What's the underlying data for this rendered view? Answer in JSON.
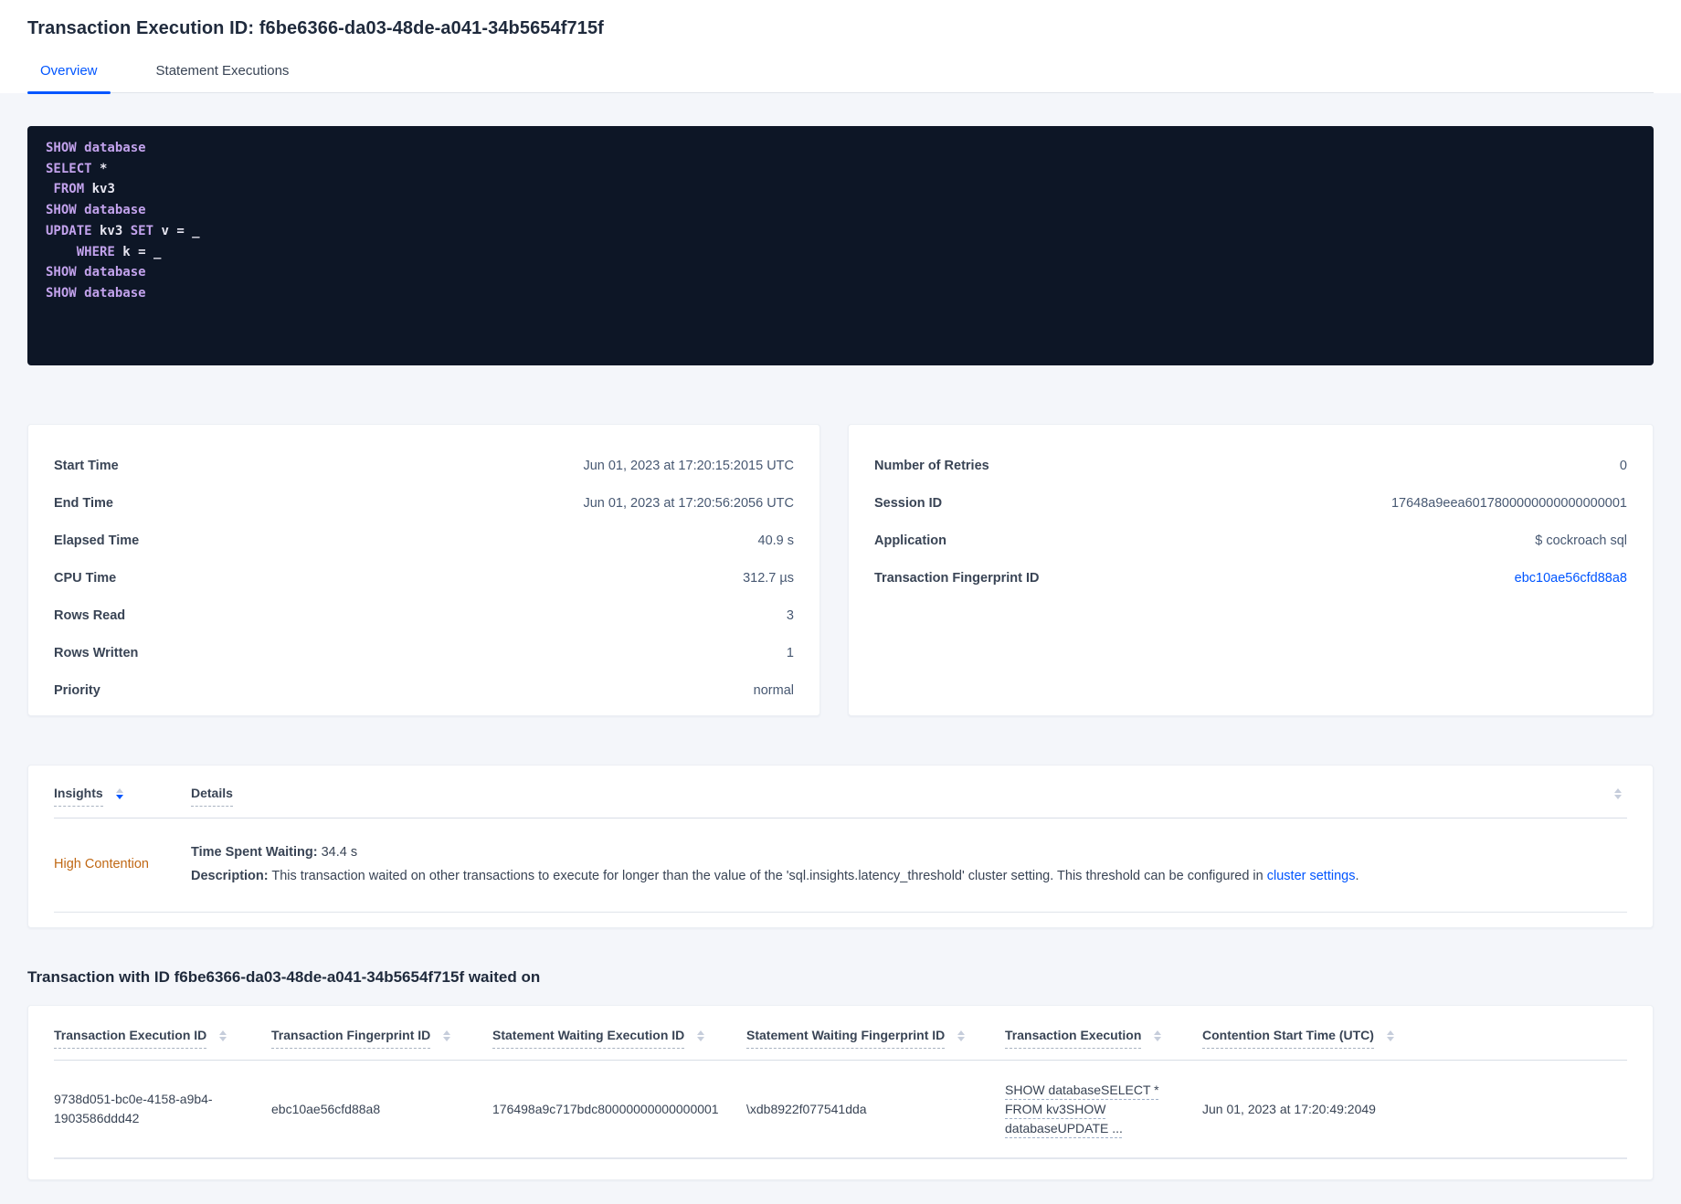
{
  "page": {
    "title": "Transaction Execution ID: f6be6366-da03-48de-a041-34b5654f715f",
    "tabs": [
      {
        "label": "Overview",
        "active": true
      },
      {
        "label": "Statement Executions",
        "active": false
      }
    ]
  },
  "sql_box": {
    "lines": [
      [
        {
          "t": "kw",
          "v": "SHOW database"
        }
      ],
      [
        {
          "t": "kw",
          "v": "SELECT"
        },
        {
          "t": "pl",
          "v": " *"
        }
      ],
      [
        {
          "t": "pl",
          "v": " "
        },
        {
          "t": "kw",
          "v": "FROM"
        },
        {
          "t": "pl",
          "v": " kv3"
        }
      ],
      [
        {
          "t": "kw",
          "v": "SHOW database"
        }
      ],
      [
        {
          "t": "kw",
          "v": "UPDATE"
        },
        {
          "t": "pl",
          "v": " kv3 "
        },
        {
          "t": "kw",
          "v": "SET"
        },
        {
          "t": "pl",
          "v": " v = _"
        }
      ],
      [
        {
          "t": "pl",
          "v": "    "
        },
        {
          "t": "kw",
          "v": "WHERE"
        },
        {
          "t": "pl",
          "v": " k = _"
        }
      ],
      [
        {
          "t": "kw",
          "v": "SHOW database"
        }
      ],
      [
        {
          "t": "kw",
          "v": "SHOW database"
        }
      ]
    ]
  },
  "summary_left": {
    "rows": [
      {
        "label": "Start Time",
        "value": "Jun 01, 2023 at 17:20:15:2015 UTC"
      },
      {
        "label": "End Time",
        "value": "Jun 01, 2023 at 17:20:56:2056 UTC"
      },
      {
        "label": "Elapsed Time",
        "value": "40.9 s"
      },
      {
        "label": "CPU Time",
        "value": "312.7 µs"
      },
      {
        "label": "Rows Read",
        "value": "3"
      },
      {
        "label": "Rows Written",
        "value": "1"
      },
      {
        "label": "Priority",
        "value": "normal"
      }
    ]
  },
  "summary_right": {
    "rows": [
      {
        "label": "Number of Retries",
        "value": "0"
      },
      {
        "label": "Session ID",
        "value": "17648a9eea6017800000000000000001"
      },
      {
        "label": "Application",
        "value": "$ cockroach sql"
      },
      {
        "label": "Transaction Fingerprint ID",
        "value": "ebc10ae56cfd88a8",
        "link": true
      }
    ]
  },
  "insights": {
    "columns": [
      {
        "label": "Insights",
        "sort": "desc"
      },
      {
        "label": "Details",
        "sort": "none"
      }
    ],
    "row": {
      "insight": "High Contention",
      "waiting_label": "Time Spent Waiting:",
      "waiting_value": "34.4 s",
      "description_label": "Description:",
      "description_text": "This transaction waited on other transactions to execute for longer than the value of the 'sql.insights.latency_threshold' cluster setting. This threshold can be configured in",
      "description_link": "cluster settings",
      "description_suffix": "."
    }
  },
  "waited_on": {
    "heading": "Transaction with ID f6be6366-da03-48de-a041-34b5654f715f waited on",
    "columns": [
      "Transaction Execution ID",
      "Transaction Fingerprint ID",
      "Statement Waiting Execution ID",
      "Statement Waiting Fingerprint ID",
      "Transaction Execution",
      "Contention Start Time (UTC)"
    ],
    "rows": [
      [
        "9738d051-bc0e-4158-a9b4-1903586ddd42",
        "ebc10ae56cfd88a8",
        "176498a9c717bdc80000000000000001",
        "\\xdb8922f077541dda",
        "SHOW databaseSELECT * FROM kv3SHOW databaseUPDATE ...",
        "Jun 01, 2023 at 17:20:49:2049"
      ]
    ]
  },
  "colors": {
    "accent_blue": "#0055ff",
    "insight_orange": "#c06814",
    "code_bg": "#0d1626",
    "code_keyword": "#c2a2ec",
    "code_plain": "#e7e6f1"
  }
}
